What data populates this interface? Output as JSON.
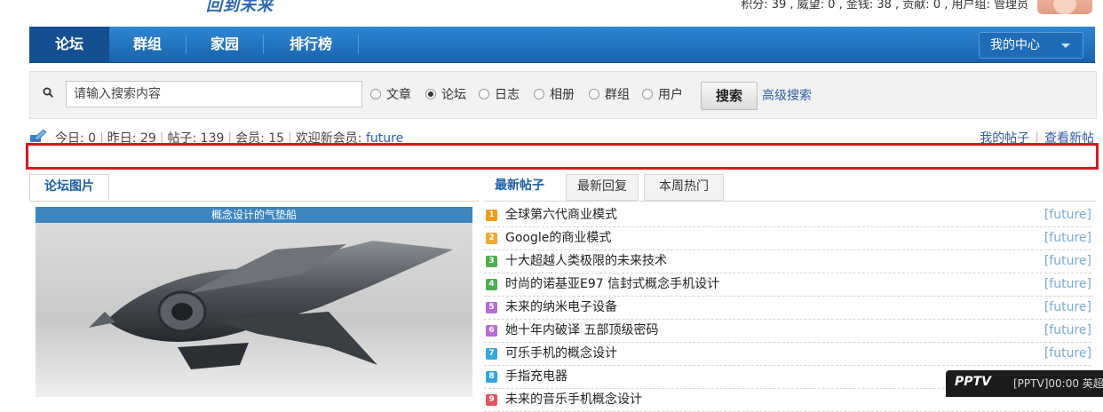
{
  "header": {
    "logo_text": "回到未来",
    "user_stats": "积分: 39 , 威望: 0 , 金钱: 38 , 贡献: 0 , 用户组: 管理员"
  },
  "nav": {
    "items": [
      {
        "label": "论坛",
        "active": true
      },
      {
        "label": "群组",
        "active": false
      },
      {
        "label": "家园",
        "active": false
      },
      {
        "label": "排行榜",
        "active": false
      }
    ],
    "my_center": "我的中心"
  },
  "search": {
    "placeholder": "请输入搜索内容",
    "options": [
      {
        "label": "文章",
        "checked": false
      },
      {
        "label": "论坛",
        "checked": true
      },
      {
        "label": "日志",
        "checked": false
      },
      {
        "label": "相册",
        "checked": false
      },
      {
        "label": "群组",
        "checked": false
      },
      {
        "label": "用户",
        "checked": false
      }
    ],
    "button": "搜索",
    "advanced": "高级搜索"
  },
  "stats": {
    "today": "今日: 0",
    "yesterday": "昨日: 29",
    "posts": "帖子: 139",
    "members": "会员: 15",
    "welcome_prefix": "欢迎新会员: ",
    "new_member": "future",
    "my_posts": "我的帖子",
    "view_new": "查看新帖"
  },
  "left_panel": {
    "tab": "论坛图片",
    "slide_caption": "概念设计的气垫船"
  },
  "right_panel": {
    "tabs": [
      {
        "label": "最新帖子",
        "active": true
      },
      {
        "label": "最新回复",
        "active": false
      },
      {
        "label": "本周热门",
        "active": false
      }
    ],
    "posts": [
      {
        "num": "1",
        "color": "#f39c12",
        "title": "全球第六代商业模式",
        "author": "[future]"
      },
      {
        "num": "2",
        "color": "#f0a830",
        "title": "Google的商业模式",
        "author": "[future]"
      },
      {
        "num": "3",
        "color": "#4cb050",
        "title": "十大超越人类极限的未来技术",
        "author": "[future]"
      },
      {
        "num": "4",
        "color": "#4cb050",
        "title": "时尚的诺基亚E97 信封式概念手机设计",
        "author": "[future]"
      },
      {
        "num": "5",
        "color": "#b86bd1",
        "title": "未来的纳米电子设备",
        "author": "[future]"
      },
      {
        "num": "6",
        "color": "#b86bd1",
        "title": "她十年内破译 五部顶级密码",
        "author": "[future]"
      },
      {
        "num": "7",
        "color": "#33a6dc",
        "title": "可乐手机的概念设计",
        "author": "[future]"
      },
      {
        "num": "8",
        "color": "#33a6dc",
        "title": "手指充电器",
        "author": "[future]"
      },
      {
        "num": "9",
        "color": "#e2555d",
        "title": "未来的音乐手机概念设计",
        "author": ""
      }
    ]
  },
  "pptv": {
    "logo": "PPTV",
    "text": "[PPTV]00:00 英超"
  }
}
